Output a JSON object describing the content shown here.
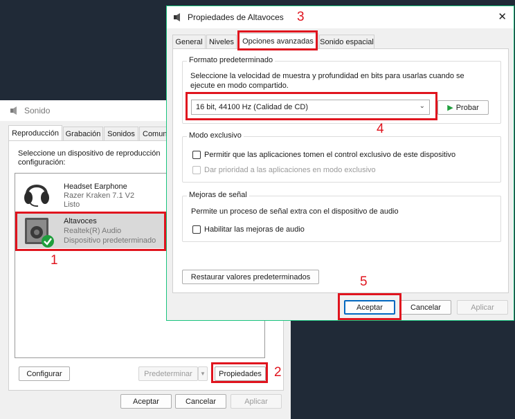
{
  "sound_window": {
    "title": "Sonido",
    "tabs": [
      "Reproducción",
      "Grabación",
      "Sonidos",
      "Comuni"
    ],
    "instruction": "Seleccione un dispositivo de reproducción",
    "instruction_line2": "configuración:",
    "devices": [
      {
        "name": "Headset Earphone",
        "model": "Razer Kraken 7.1 V2",
        "status": "Listo"
      },
      {
        "name": "Altavoces",
        "model": "Realtek(R) Audio",
        "status": "Dispositivo predeterminado"
      }
    ],
    "configure_label": "Configurar",
    "set_default_label": "Predeterminar",
    "properties_label": "Propiedades",
    "ok_label": "Aceptar",
    "cancel_label": "Cancelar",
    "apply_label": "Aplicar"
  },
  "props_window": {
    "title": "Propiedades de Altavoces",
    "tabs": [
      "General",
      "Niveles",
      "Opciones avanzadas",
      "Sonido espacial"
    ],
    "default_format": {
      "title": "Formato predeterminado",
      "description_line1": "Seleccione la velocidad de muestra y profundidad en bits para usarlas cuando se",
      "description_line2": "ejecute en modo compartido.",
      "selected_value": "16 bit, 44100 Hz (Calidad de CD)",
      "test_label": "Probar"
    },
    "exclusive_mode": {
      "title": "Modo exclusivo",
      "allow_label": "Permitir que las aplicaciones tomen el control exclusivo de este dispositivo",
      "priority_label": "Dar prioridad a las aplicaciones en modo exclusivo"
    },
    "signal_enhancements": {
      "title": "Mejoras de señal",
      "description": "Permite un proceso de señal extra con el dispositivo de audio",
      "enable_label": "Habilitar las mejoras de audio"
    },
    "restore_label": "Restaurar valores predeterminados",
    "ok_label": "Aceptar",
    "cancel_label": "Cancelar",
    "apply_label": "Aplicar",
    "close_symbol": "✕"
  },
  "annotations": [
    "1",
    "2",
    "3",
    "4",
    "5"
  ],
  "colors": {
    "accent_border": "#19c37d",
    "annotation_red": "#e0141e",
    "check_green": "#1f9e3d"
  }
}
